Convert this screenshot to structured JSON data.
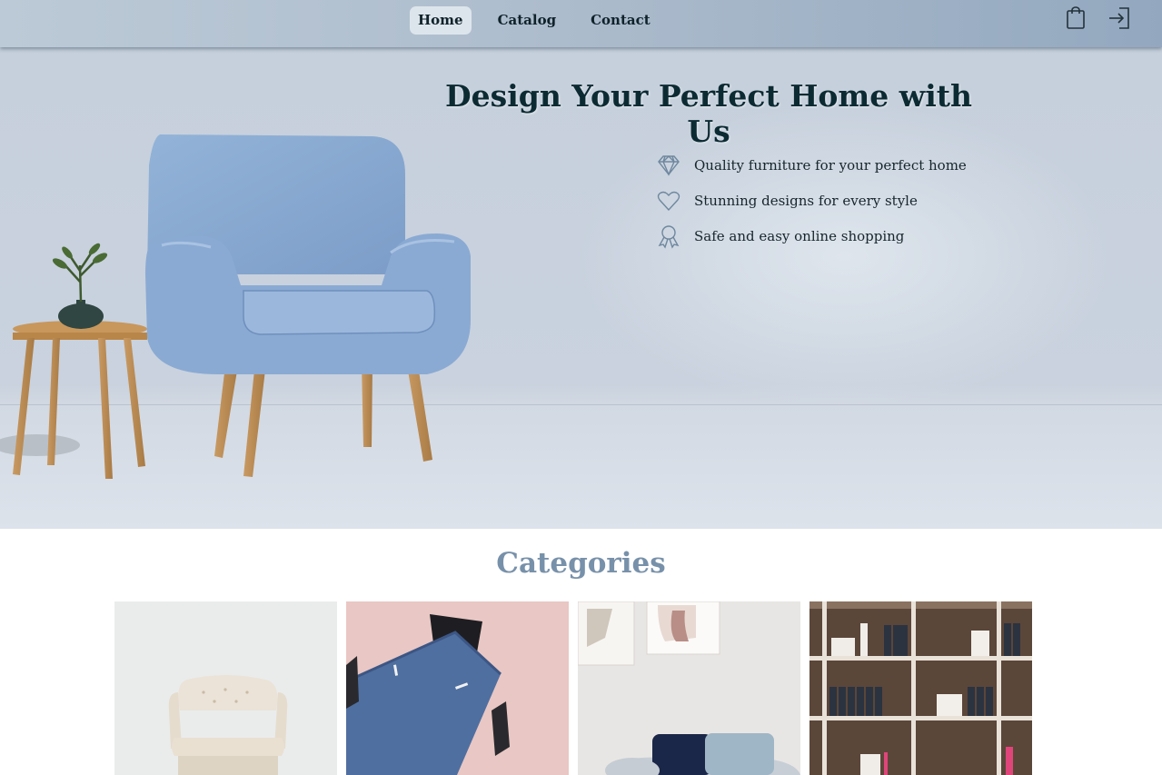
{
  "nav": {
    "links": [
      {
        "label": "Home",
        "active": true
      },
      {
        "label": "Catalog",
        "active": false
      },
      {
        "label": "Contact",
        "active": false
      }
    ],
    "icons": [
      "shopping-bag-icon",
      "sign-in-icon"
    ]
  },
  "hero": {
    "title": "Design Your Perfect Home with Us",
    "features": [
      {
        "icon": "diamond-icon",
        "text": "Quality furniture for your perfect home"
      },
      {
        "icon": "heart-icon",
        "text": "Stunning designs for every style"
      },
      {
        "icon": "award-ribbon-icon",
        "text": "Safe and easy online shopping"
      }
    ]
  },
  "categories": {
    "title": "Categories",
    "items": [
      {
        "image": "white tufted armchair"
      },
      {
        "image": "blue table with black chairs"
      },
      {
        "image": "sofa with cushions and wall art"
      },
      {
        "image": "wooden bookshelf with binders"
      }
    ]
  },
  "colors": {
    "nav_bg": "#aebdcd",
    "active_tab_bg": "#dde5ec",
    "title_color": "#0c2a32",
    "categories_title_color": "#7891aa",
    "icon_stroke": "#6f879e"
  }
}
